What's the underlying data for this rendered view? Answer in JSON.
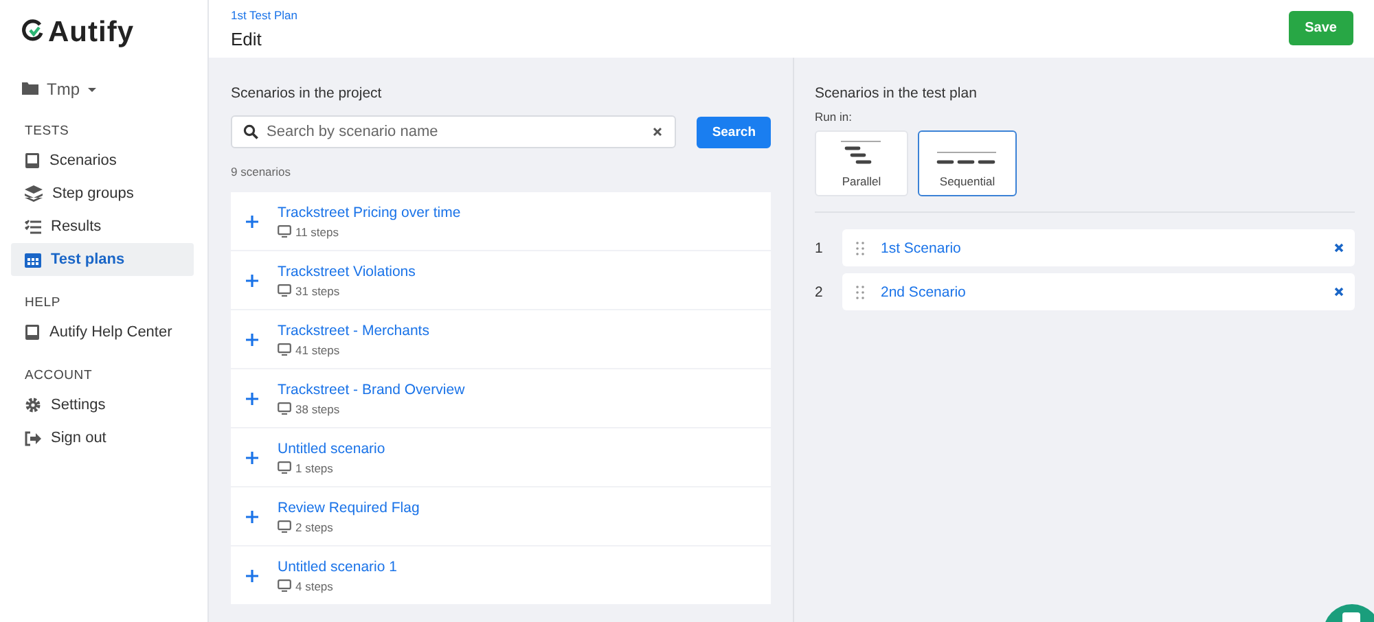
{
  "sidebar": {
    "logo": "Autify",
    "project": "Tmp",
    "sections": [
      {
        "heading": "TESTS",
        "items": [
          {
            "label": "Scenarios",
            "selected": false
          },
          {
            "label": "Step groups",
            "selected": false
          },
          {
            "label": "Results",
            "selected": false
          },
          {
            "label": "Test plans",
            "selected": true
          }
        ]
      },
      {
        "heading": "HELP",
        "items": [
          {
            "label": "Autify Help Center",
            "selected": false
          }
        ]
      },
      {
        "heading": "ACCOUNT",
        "items": [
          {
            "label": "Settings",
            "selected": false
          },
          {
            "label": "Sign out",
            "selected": false
          }
        ]
      }
    ]
  },
  "header": {
    "breadcrumb": "1st Test Plan",
    "title": "Edit",
    "save_button": "Save"
  },
  "project_scenarios": {
    "heading": "Scenarios in the project",
    "search": {
      "placeholder": "Search by scenario name",
      "button": "Search"
    },
    "count": "9 scenarios",
    "items": [
      {
        "name": "Trackstreet Pricing over time",
        "steps": "11 steps"
      },
      {
        "name": "Trackstreet Violations",
        "steps": "31 steps"
      },
      {
        "name": "Trackstreet - Merchants",
        "steps": "41 steps"
      },
      {
        "name": "Trackstreet - Brand Overview",
        "steps": "38 steps"
      },
      {
        "name": "Untitled scenario",
        "steps": "1 steps"
      },
      {
        "name": "Review Required Flag",
        "steps": "2 steps"
      },
      {
        "name": "Untitled scenario 1",
        "steps": "4 steps"
      }
    ]
  },
  "test_plan": {
    "heading": "Scenarios in the test plan",
    "run_in_label": "Run in:",
    "run_modes": [
      {
        "label": "Parallel",
        "kind": "parallel",
        "selected": false
      },
      {
        "label": "Sequential",
        "kind": "sequential",
        "selected": true
      }
    ],
    "scenarios": [
      {
        "number": "1",
        "name": "1st Scenario"
      },
      {
        "number": "2",
        "name": "2nd Scenario"
      }
    ]
  }
}
